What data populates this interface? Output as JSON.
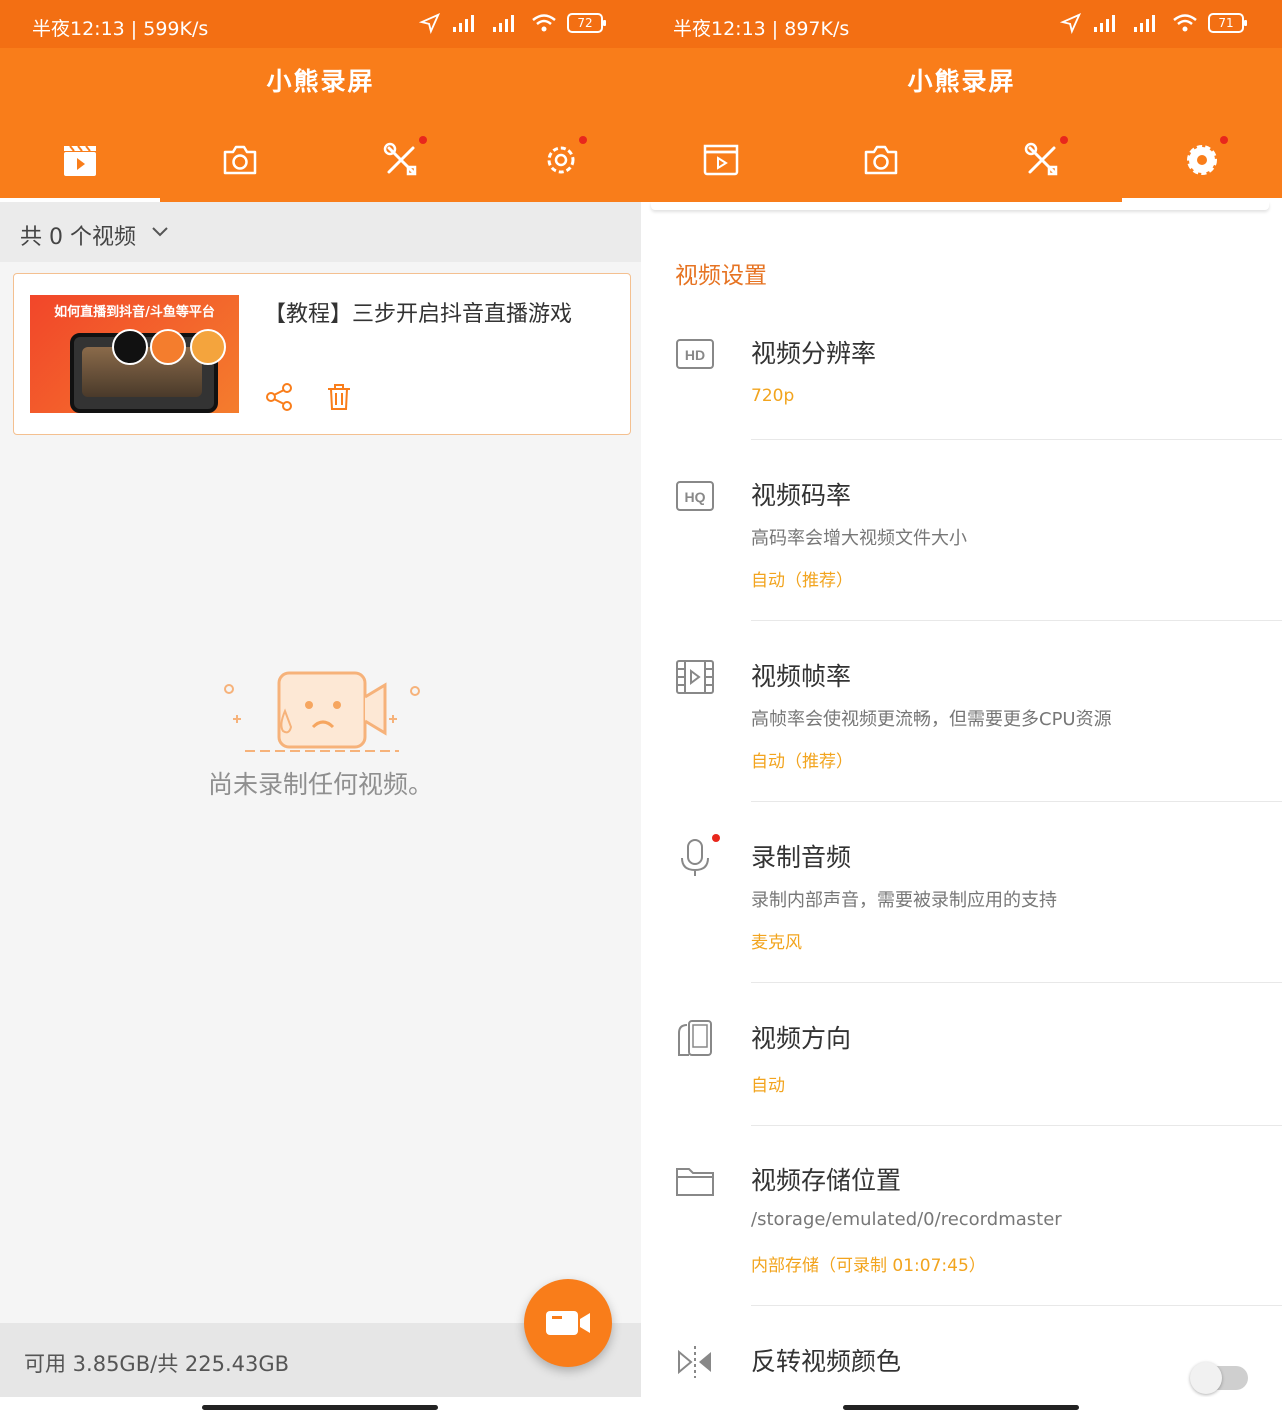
{
  "left": {
    "status": {
      "time_speed": "半夜12:13 | 599K/s",
      "battery": "72"
    },
    "app_title": "小熊录屏",
    "video_count": "共 0 个视频",
    "card": {
      "title": "【教程】三步开启抖音直播游戏",
      "thumb_caption": "如何直播到抖音/斗鱼等平台"
    },
    "empty_message": "尚未录制任何视频。",
    "storage": "可用 3.85GB/共 225.43GB"
  },
  "right": {
    "status": {
      "time_speed": "半夜12:13 | 897K/s",
      "battery": "71"
    },
    "app_title": "小熊录屏",
    "section_title": "视频设置",
    "settings": [
      {
        "title": "视频分辨率",
        "value": "720p",
        "icon": "hd-icon"
      },
      {
        "title": "视频码率",
        "desc": "高码率会增大视频文件大小",
        "value": "自动（推荐）",
        "icon": "hq-icon"
      },
      {
        "title": "视频帧率",
        "desc": "高帧率会使视频更流畅，但需要更多CPU资源",
        "value": "自动（推荐）",
        "icon": "film-icon"
      },
      {
        "title": "录制音频",
        "desc": "录制内部声音，需要被录制应用的支持",
        "value": "麦克风",
        "icon": "microphone-icon"
      },
      {
        "title": "视频方向",
        "value": "自动",
        "icon": "rotate-phone-icon"
      },
      {
        "title": "视频存储位置",
        "desc": "/storage/emulated/0/recordmaster",
        "value": "内部存储（可录制 01:07:45）",
        "icon": "folder-icon"
      },
      {
        "title": "反转视频颜色",
        "icon": "invert-icon"
      }
    ]
  },
  "colors": {
    "accent": "#f97d1a",
    "status_bar": "#f36f13",
    "value_text": "#f2a41e",
    "section_text": "#e67322"
  }
}
